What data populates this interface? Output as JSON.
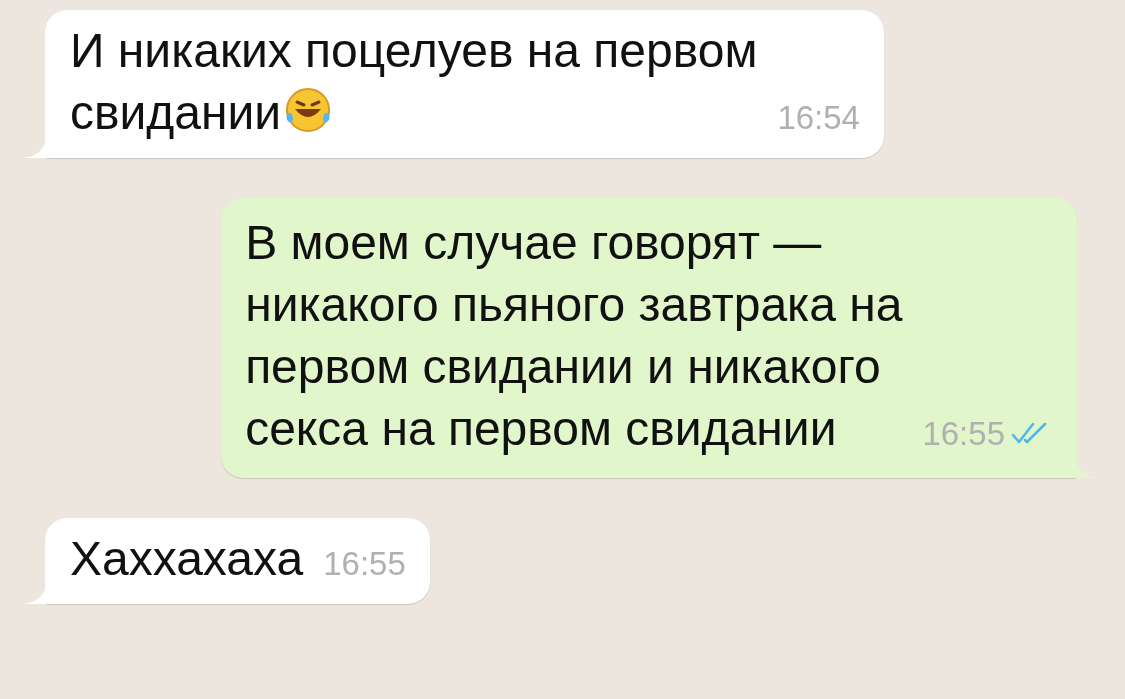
{
  "messages": [
    {
      "kind": "incoming",
      "lines": [
        "И никаких поцелуев на первом",
        "свидании"
      ],
      "emoji_after": true,
      "time": "16:54"
    },
    {
      "kind": "outgoing",
      "lines": [
        "В моем случае говорят —",
        "никакого пьяного завтрака на",
        "первом свидании и никакого",
        "секса на первом свидании"
      ],
      "time": "16:55",
      "read": true
    },
    {
      "kind": "incoming",
      "lines": [
        "Хаххахаха"
      ],
      "time": "16:55"
    }
  ]
}
